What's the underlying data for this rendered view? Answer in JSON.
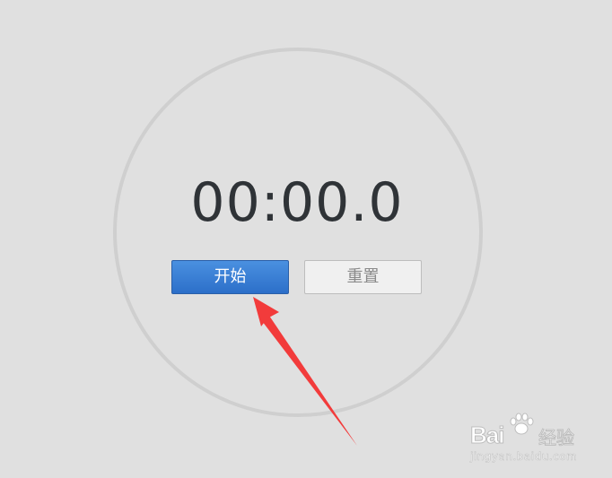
{
  "stopwatch": {
    "time_display": "00:00.0",
    "start_label": "开始",
    "reset_label": "重置"
  },
  "annotation": {
    "arrow_color": "#f23b3b"
  },
  "watermark": {
    "logo_text": "Bai",
    "logo_text_2": "经验",
    "url": "jingyan.baidu.com"
  },
  "colors": {
    "background": "#e0e0e0",
    "dial_ring": "#cfcfcf",
    "start_button": "#2c6fc9",
    "reset_button": "#f0f0f0",
    "time_text": "#2f3337"
  }
}
